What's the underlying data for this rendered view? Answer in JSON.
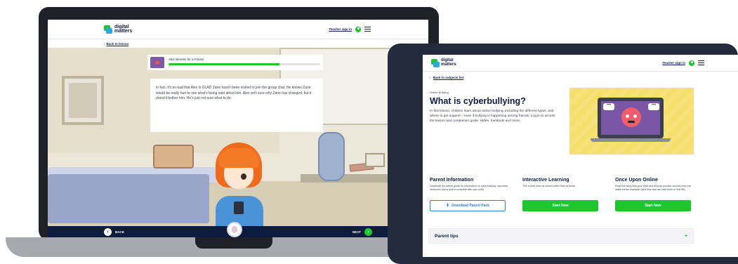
{
  "laptop": {
    "logo_line1": "digital",
    "logo_line2": "matters",
    "teacher_link": "Teacher sign in",
    "back_link": "Back to lesson",
    "lesson_title": "Alex Worries for a Friend",
    "progress": {
      "percent": 73,
      "label": "X of Y"
    },
    "story_text": "In fact, it's so bad that Alex is GLAD Zane hasn't been invited to join the group chat. He knows Zane would be really hurt to see what's being said about him. Alex isn't sure why Zane has changed, but it doesn't bother him. He's just not sure what to do.",
    "footer": {
      "back_label": "BACK",
      "next_label": "NEXT"
    }
  },
  "tablet": {
    "logo_line1": "digital",
    "logo_line2": "matters",
    "teacher_link": "Teacher sign in",
    "back_link": "Back to subjects list",
    "kicker": "Online Bullying",
    "title": "What is cyberbullying?",
    "description": "In this lesson, children learn about online bullying, including the different types, and where to get support – even if bullying is happening among friends. Log in to access the lesson and companion guide, slides, handouts and more.",
    "columns": [
      {
        "title": "Parent Information",
        "text": "Download the parent guide for information on cyberbullying, important resources and a quiz to complete with your child.",
        "button": "Download Parent Pack"
      },
      {
        "title": "Interactive Learning",
        "text": "This is best done at school rather than at home.",
        "button": "Start Now"
      },
      {
        "title": "Once Upon Online",
        "text": "Read the story with your child and discuss positive choices they can make for the character (and how that can help them in real life).",
        "button": "Start Now"
      }
    ],
    "accordion": {
      "label": "Parent tips",
      "icon": "+"
    }
  },
  "colors": {
    "brand_green": "#1fc72e",
    "brand_blue": "#2aa8e0",
    "navy": "#0d1b3e",
    "device_frame": "#242b3d"
  }
}
